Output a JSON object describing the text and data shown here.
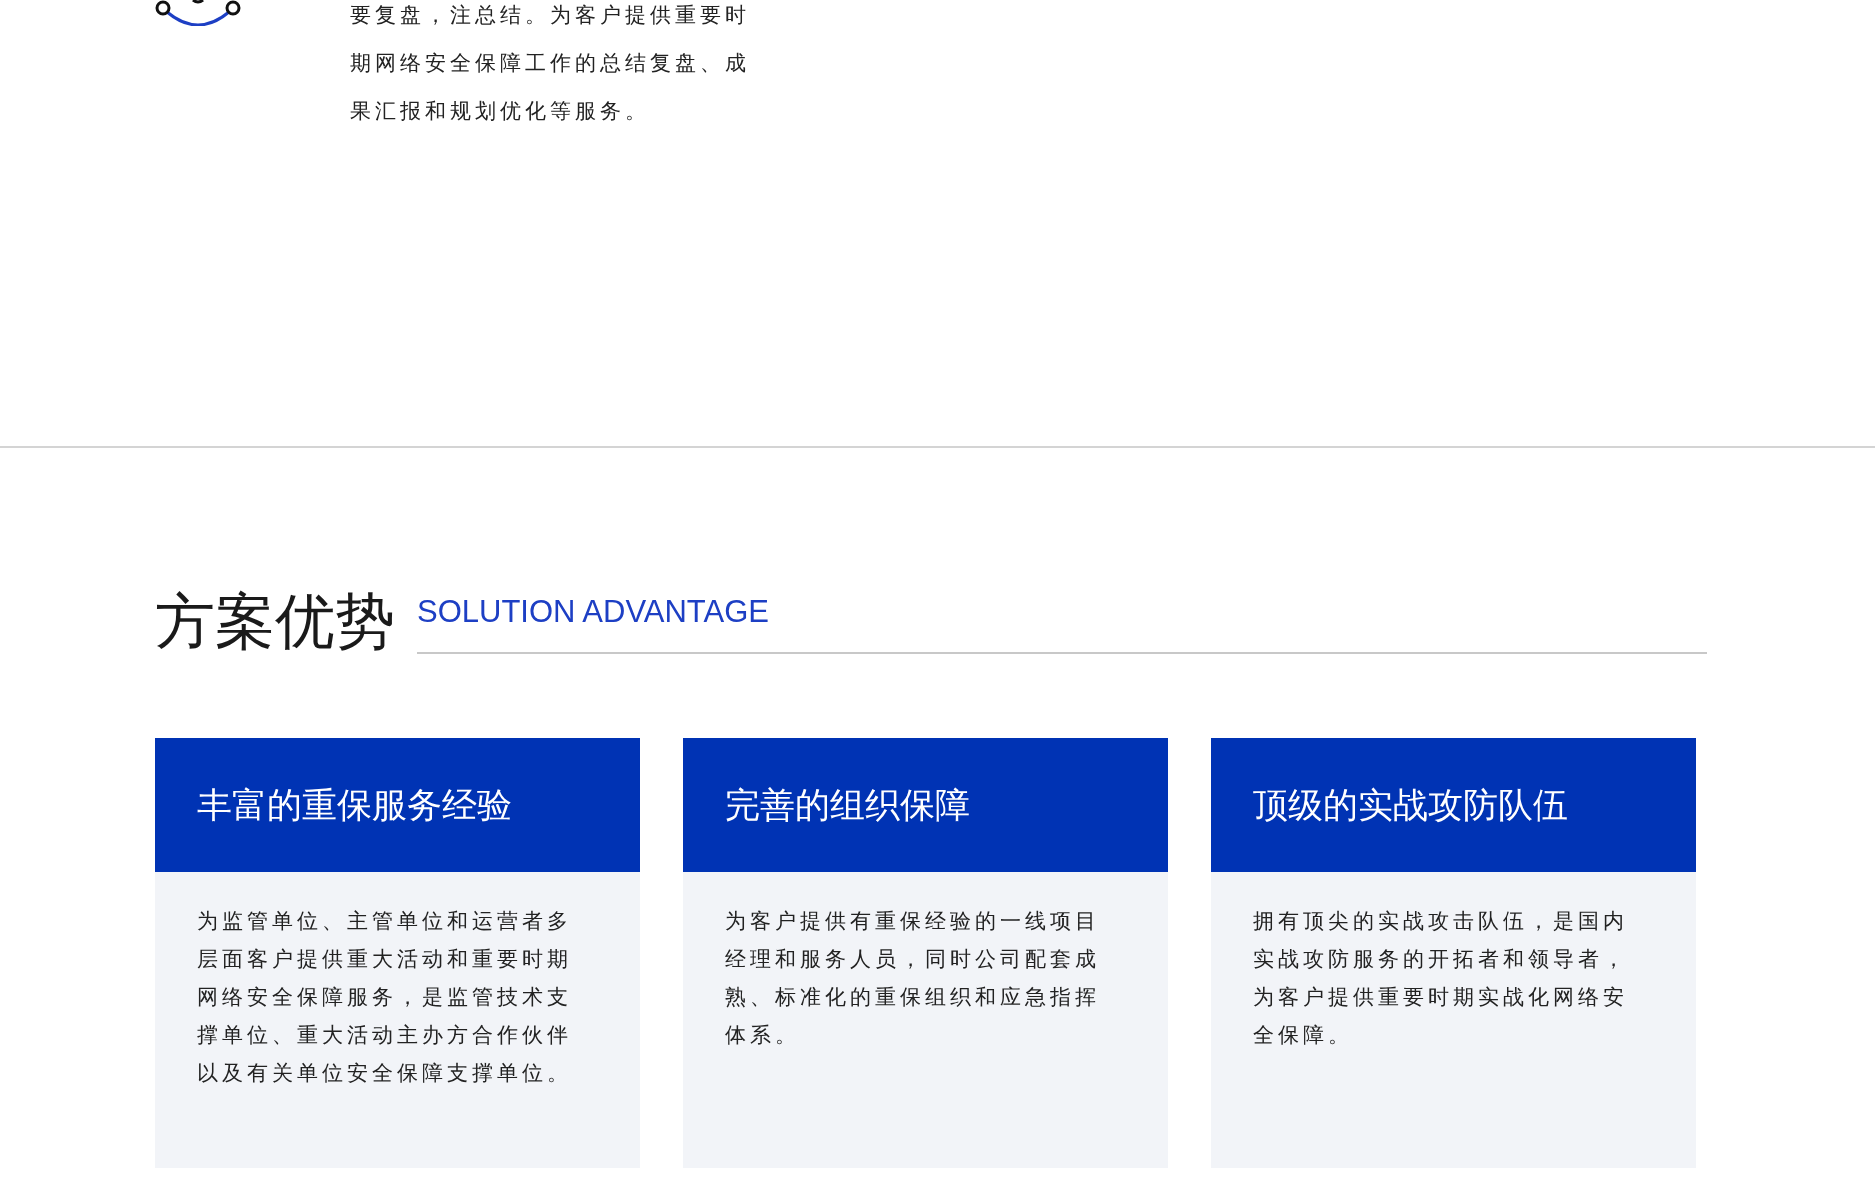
{
  "intro": {
    "text": "要复盘，注总结。为客户提供重要时期网络安全保障工作的总结复盘、成果汇报和规划优化等服务。"
  },
  "section": {
    "title": "方案优势",
    "subtitle": "SOLUTION ADVANTAGE"
  },
  "cards": [
    {
      "title": "丰富的重保服务经验",
      "text": "为监管单位、主管单位和运营者多层面客户提供重大活动和重要时期网络安全保障服务，是监管技术支撑单位、重大活动主办方合作伙伴以及有关单位安全保障支撑单位。"
    },
    {
      "title": "完善的组织保障",
      "text": "为客户提供有重保经验的一线项目经理和服务人员，同时公司配套成熟、标准化的重保组织和应急指挥体系。"
    },
    {
      "title": "顶级的实战攻防队伍",
      "text": "拥有顶尖的实战攻击队伍，是国内实战攻防服务的开拓者和领导者，为客户提供重要时期实战化网络安全保障。"
    }
  ]
}
